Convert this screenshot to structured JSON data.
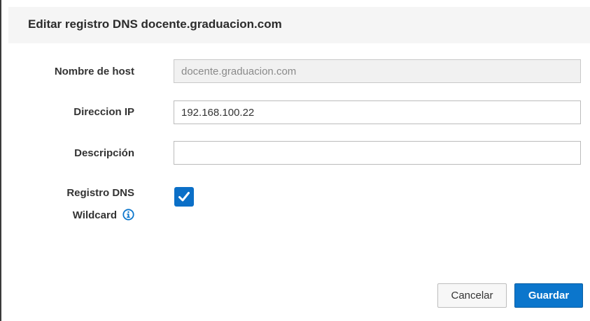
{
  "dialog": {
    "title": "Editar registro DNS docente.graduacion.com"
  },
  "form": {
    "hostname": {
      "label": "Nombre de host",
      "value": "docente.graduacion.com"
    },
    "ip": {
      "label": "Direccion IP",
      "value": "192.168.100.22"
    },
    "description": {
      "label": "Descripción",
      "value": ""
    },
    "wildcard": {
      "label_line1": "Registro DNS",
      "label_line2": "Wildcard",
      "checked": true,
      "info_icon": "info-circle-icon"
    }
  },
  "buttons": {
    "cancel_label": "Cancelar",
    "save_label": "Guardar"
  },
  "colors": {
    "primary": "#0b76cc",
    "checkbox": "#0b6fc7",
    "header_bg": "#f5f5f5"
  }
}
